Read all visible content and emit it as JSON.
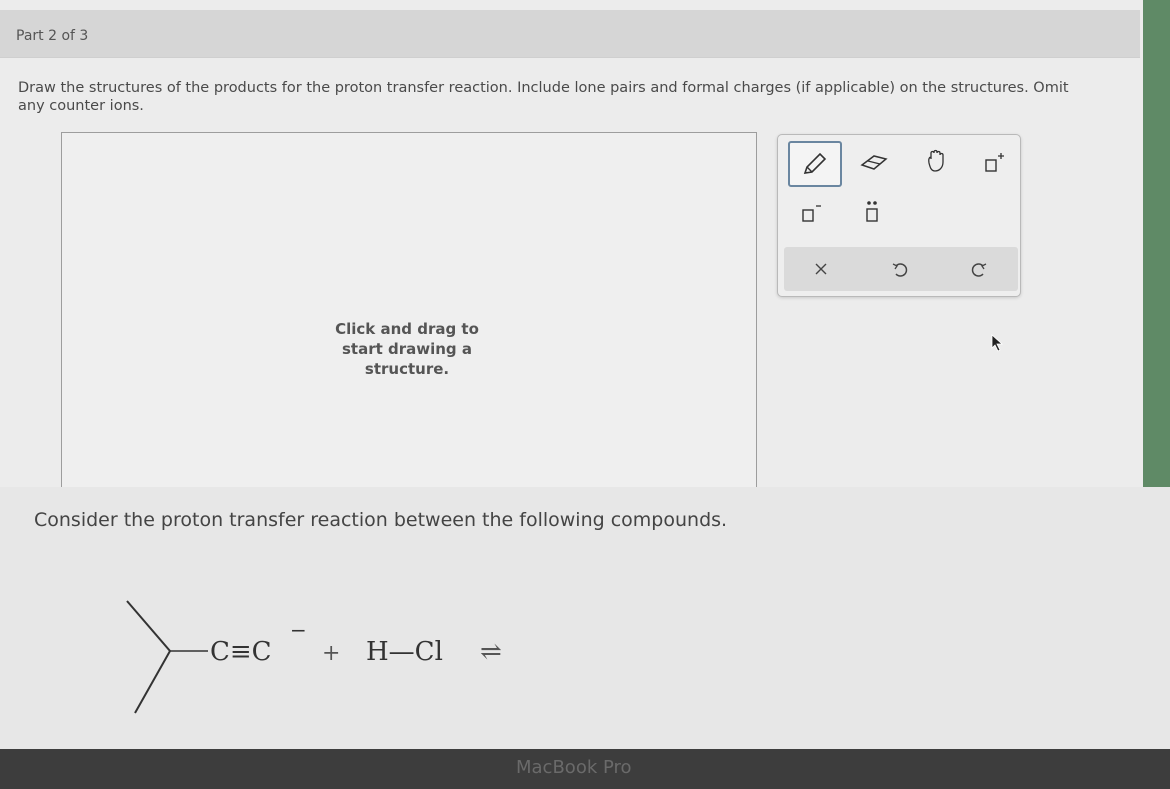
{
  "header": {
    "part_label": "Part 2 of 3"
  },
  "instructions": "Draw the structures of the products for the proton transfer reaction. Include lone pairs and formal charges (if applicable) on the structures. Omit any counter ions.",
  "canvas": {
    "hint": "Click and drag to start drawing a structure."
  },
  "toolbar": {
    "tools": [
      {
        "name": "pencil-icon",
        "active": true
      },
      {
        "name": "eraser-icon",
        "active": false
      },
      {
        "name": "hand-icon",
        "active": false
      },
      {
        "name": "positive-charge-icon",
        "active": false
      },
      {
        "name": "negative-charge-icon",
        "active": false
      },
      {
        "name": "lone-pair-icon",
        "active": false
      }
    ],
    "actions": [
      {
        "name": "clear-icon",
        "glyph": "×"
      },
      {
        "name": "undo-icon",
        "glyph": "↶"
      },
      {
        "name": "redo-icon",
        "glyph": "↷"
      }
    ]
  },
  "question": "Consider the proton transfer reaction between the following compounds.",
  "reaction": {
    "reactant1_text": "C≡C",
    "reactant1_charge": "−",
    "plus": "+",
    "reactant2_text": "H—Cl",
    "equilibrium": "⇌"
  },
  "bezel_label": "MacBook Pro"
}
